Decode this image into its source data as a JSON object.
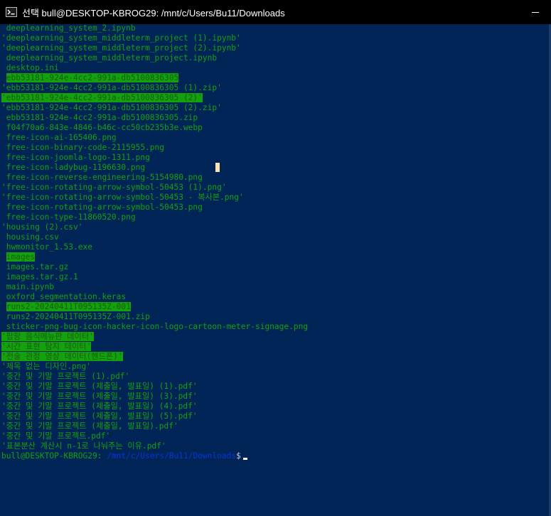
{
  "window": {
    "title": "선택 bull@DESKTOP-KBROG29: /mnt/c/Users/Bu11/Downloads"
  },
  "icons": {
    "app": "terminal-icon",
    "minimize": "minimize-icon"
  },
  "colors": {
    "background": "#012456",
    "text_green": "#13a10e",
    "highlight_bg": "#13a10e",
    "path_blue": "#0037da",
    "titlebar": "#000000"
  },
  "listing": [
    {
      "text": " deeplearning_system_2.ipynb",
      "highlight": false
    },
    {
      "text": "'deeplearning_system_middleterm_project (1).ipynb'",
      "highlight": false
    },
    {
      "text": "'deeplearning_system_middleterm_project (2).ipynb'",
      "highlight": false
    },
    {
      "text": " deeplearning_system_middleterm_project.ipynb",
      "highlight": false
    },
    {
      "text": " desktop.ini",
      "highlight": false
    },
    {
      "text": "ebb53181-924e-4cc2-991a-db5100836305",
      "highlight": true,
      "indent": " "
    },
    {
      "text": "'ebb53181-924e-4cc2-991a-db5100836305 (1).zip'",
      "highlight": false
    },
    {
      "text": "'ebb53181-924e-4cc2-991a-db5100836305 (2)'",
      "highlight": true,
      "indent": ""
    },
    {
      "text": "'ebb53181-924e-4cc2-991a-db5100836305 (2).zip'",
      "highlight": false
    },
    {
      "text": " ebb53181-924e-4cc2-991a-db5100836305.zip",
      "highlight": false
    },
    {
      "text": " f04f70a6-843e-4846-b46c-cc50cb235b3e.webp",
      "highlight": false
    },
    {
      "text": " free-icon-ai-165406.png",
      "highlight": false
    },
    {
      "text": " free-icon-binary-code-2115955.png",
      "highlight": false
    },
    {
      "text": " free-icon-joomla-logo-1311.png",
      "highlight": false
    },
    {
      "text": " free-icon-ladybug-1196630.png",
      "highlight": false
    },
    {
      "text": " free-icon-reverse-engineering-5154980.png",
      "highlight": false
    },
    {
      "text": "'free-icon-rotating-arrow-symbol-50453 (1).png'",
      "highlight": false
    },
    {
      "text": "'free-icon-rotating-arrow-symbol-50453 - 복사본.png'",
      "highlight": false
    },
    {
      "text": " free-icon-rotating-arrow-symbol-50453.png",
      "highlight": false
    },
    {
      "text": " free-icon-type-11860520.png",
      "highlight": false
    },
    {
      "text": "'housing (2).csv'",
      "highlight": false
    },
    {
      "text": " housing.csv",
      "highlight": false
    },
    {
      "text": " hwmonitor_1.53.exe",
      "highlight": false
    },
    {
      "text": "images",
      "highlight": true,
      "indent": " "
    },
    {
      "text": " images.tar.gz",
      "highlight": false
    },
    {
      "text": " images.tar.gz.1",
      "highlight": false
    },
    {
      "text": " main.ipynb",
      "highlight": false
    },
    {
      "text": " oxford_segmentation.keras",
      "highlight": false
    },
    {
      "text": "runs2-20240411T095135Z-001",
      "highlight": true,
      "indent": " "
    },
    {
      "text": " runs2-20240411T095135Z-001.zip",
      "highlight": false
    },
    {
      "text": " sticker-png-bug-icon-hacker-icon-logo-cartoon-meter-signage.png",
      "highlight": false
    },
    {
      "text": "'팝팡 음식메뉴판 데이터'",
      "highlight": true,
      "indent": ""
    },
    {
      "text": "'시간 표현 탐지 데이터'",
      "highlight": true,
      "indent": ""
    },
    {
      "text": "'전술 관정 영상 데이터(헨드폰)'",
      "highlight": true,
      "indent": ""
    },
    {
      "text": "'제목 없는 디자인.png'",
      "highlight": false
    },
    {
      "text": "'중간 및 기말 프로젝트 (1).pdf'",
      "highlight": false
    },
    {
      "text": "'중간 및 기말 프로젝트 (제출일, 발표일) (1).pdf'",
      "highlight": false
    },
    {
      "text": "'중간 및 기말 프로젝트 (제출일, 발표일) (3).pdf'",
      "highlight": false
    },
    {
      "text": "'중간 및 기말 프로젝트 (제출일, 발표일) (4).pdf'",
      "highlight": false
    },
    {
      "text": "'중간 및 기말 프로젝트 (제출일, 발표일) (5).pdf'",
      "highlight": false
    },
    {
      "text": "'중간 및 기말 프로젝트 (제출일, 발표일).pdf'",
      "highlight": false
    },
    {
      "text": "'중간 및 기말 프로젝트.pdf'",
      "highlight": false
    },
    {
      "text": "'표본분산 계산시 n-1로 나눠주는 이유.pdf'",
      "highlight": false
    }
  ],
  "prompt": {
    "user_host": "bull@DESKTOP-KBROG29",
    "separator": ":",
    "path": " /mnt/c/Users/Bu11/Downloads",
    "symbol": "$"
  }
}
